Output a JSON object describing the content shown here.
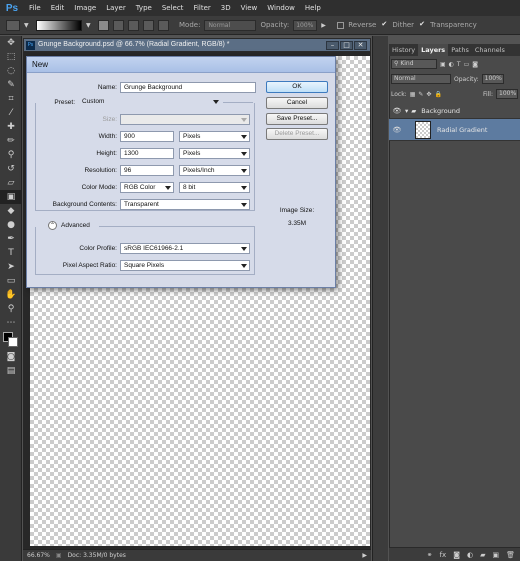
{
  "menubar": {
    "logo": "Ps",
    "items": [
      "File",
      "Edit",
      "Image",
      "Layer",
      "Type",
      "Select",
      "Filter",
      "3D",
      "View",
      "Window",
      "Help"
    ]
  },
  "options": {
    "mode_label": "Mode:",
    "mode_value": "Normal",
    "opacity_label": "Opacity:",
    "opacity_value": "100%",
    "reverse_label": "Reverse",
    "dither_label": "Dither",
    "transparency_label": "Transparency",
    "reverse_checked": false,
    "dither_checked": true,
    "transparency_checked": true
  },
  "document": {
    "title": "Grunge Background.psd @ 66.7% (Radial Gradient, RGB/8) *",
    "zoom": "66.67%",
    "doc_info": "Doc: 3.35M/0 bytes"
  },
  "panel": {
    "tabs": [
      "History",
      "Layers",
      "Paths",
      "Channels"
    ],
    "active_tab": "Layers",
    "kind_label": "Kind",
    "blend_mode": "Normal",
    "opacity_label": "Opacity:",
    "opacity_value": "100%",
    "lock_label": "Lock:",
    "fill_label": "Fill:",
    "fill_value": "100%",
    "layers": [
      {
        "name": "Background",
        "type": "group"
      },
      {
        "name": "Radial Gradient",
        "type": "layer"
      }
    ]
  },
  "dialog": {
    "title": "New",
    "name_label": "Name:",
    "name_value": "Grunge Background",
    "preset_label": "Preset:",
    "preset_value": "Custom",
    "size_label": "Size:",
    "size_value": "",
    "width_label": "Width:",
    "width_value": "900",
    "width_unit": "Pixels",
    "height_label": "Height:",
    "height_value": "1300",
    "height_unit": "Pixels",
    "resolution_label": "Resolution:",
    "resolution_value": "96",
    "resolution_unit": "Pixels/Inch",
    "color_mode_label": "Color Mode:",
    "color_mode_value": "RGB Color",
    "bit_depth": "8 bit",
    "bg_contents_label": "Background Contents:",
    "bg_contents_value": "Transparent",
    "advanced_label": "Advanced",
    "color_profile_label": "Color Profile:",
    "color_profile_value": "sRGB IEC61966-2.1",
    "pixel_aspect_label": "Pixel Aspect Ratio:",
    "pixel_aspect_value": "Square Pixels",
    "ok_label": "OK",
    "cancel_label": "Cancel",
    "save_preset_label": "Save Preset...",
    "delete_preset_label": "Delete Preset...",
    "image_size_label": "Image Size:",
    "image_size_value": "3.35M"
  }
}
